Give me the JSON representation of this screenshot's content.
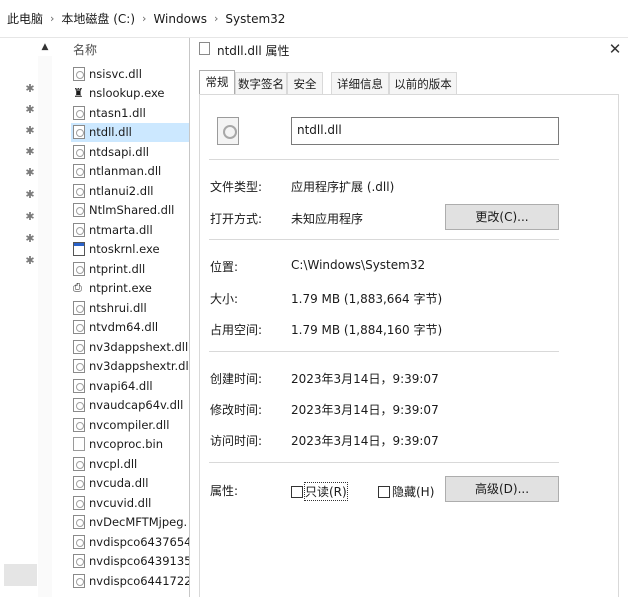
{
  "breadcrumb": [
    "此电脑",
    "本地磁盘 (C:)",
    "Windows",
    "System32"
  ],
  "file_list": {
    "column_header": "名称",
    "files": [
      {
        "name": "nsisvc.dll",
        "icon": "dll-file-icon"
      },
      {
        "name": "nslookup.exe",
        "icon": "nslookup-exe-icon"
      },
      {
        "name": "ntasn1.dll",
        "icon": "dll-file-icon"
      },
      {
        "name": "ntdll.dll",
        "icon": "dll-file-icon",
        "selected": true
      },
      {
        "name": "ntdsapi.dll",
        "icon": "dll-file-icon"
      },
      {
        "name": "ntlanman.dll",
        "icon": "dll-file-icon"
      },
      {
        "name": "ntlanui2.dll",
        "icon": "dll-file-icon"
      },
      {
        "name": "NtlmShared.dll",
        "icon": "dll-file-icon"
      },
      {
        "name": "ntmarta.dll",
        "icon": "dll-file-icon"
      },
      {
        "name": "ntoskrnl.exe",
        "icon": "exe-file-icon"
      },
      {
        "name": "ntprint.dll",
        "icon": "dll-file-icon"
      },
      {
        "name": "ntprint.exe",
        "icon": "printer-exe-icon"
      },
      {
        "name": "ntshrui.dll",
        "icon": "dll-file-icon"
      },
      {
        "name": "ntvdm64.dll",
        "icon": "dll-file-icon"
      },
      {
        "name": "nv3dappshext.dll",
        "icon": "dll-file-icon"
      },
      {
        "name": "nv3dappshextr.dll",
        "icon": "dll-file-icon"
      },
      {
        "name": "nvapi64.dll",
        "icon": "dll-file-icon"
      },
      {
        "name": "nvaudcap64v.dll",
        "icon": "dll-file-icon"
      },
      {
        "name": "nvcompiler.dll",
        "icon": "dll-file-icon"
      },
      {
        "name": "nvcoproc.bin",
        "icon": "bin-file-icon"
      },
      {
        "name": "nvcpl.dll",
        "icon": "dll-file-icon"
      },
      {
        "name": "nvcuda.dll",
        "icon": "dll-file-icon"
      },
      {
        "name": "nvcuvid.dll",
        "icon": "dll-file-icon"
      },
      {
        "name": "nvDecMFTMjpeg.",
        "icon": "dll-file-icon"
      },
      {
        "name": "nvdispco6437654",
        "icon": "dll-file-icon"
      },
      {
        "name": "nvdispco6439135",
        "icon": "dll-file-icon"
      },
      {
        "name": "nvdispco6441722",
        "icon": "dll-file-icon"
      }
    ]
  },
  "dialog": {
    "title": "ntdll.dll 属性",
    "close_glyph": "✕",
    "tabs": [
      "常规",
      "数字签名",
      "安全",
      "详细信息",
      "以前的版本"
    ],
    "file_name": "ntdll.dll",
    "rows": {
      "file_type_label": "文件类型:",
      "file_type_value": "应用程序扩展 (.dll)",
      "open_with_label": "打开方式:",
      "open_with_value": "未知应用程序",
      "change_button": "更改(C)...",
      "location_label": "位置:",
      "location_value": "C:\\Windows\\System32",
      "size_label": "大小:",
      "size_value": "1.79 MB (1,883,664 字节)",
      "size_on_disk_label": "占用空间:",
      "size_on_disk_value": "1.79 MB (1,884,160 字节)",
      "created_label": "创建时间:",
      "created_value": "2023年3月14日，9:39:07",
      "modified_label": "修改时间:",
      "modified_value": "2023年3月14日，9:39:07",
      "accessed_label": "访问时间:",
      "accessed_value": "2023年3月14日，9:39:07",
      "attributes_label": "属性:",
      "readonly_label": "只读(R)",
      "hidden_label": "隐藏(H)",
      "advanced_button": "高级(D)..."
    }
  }
}
